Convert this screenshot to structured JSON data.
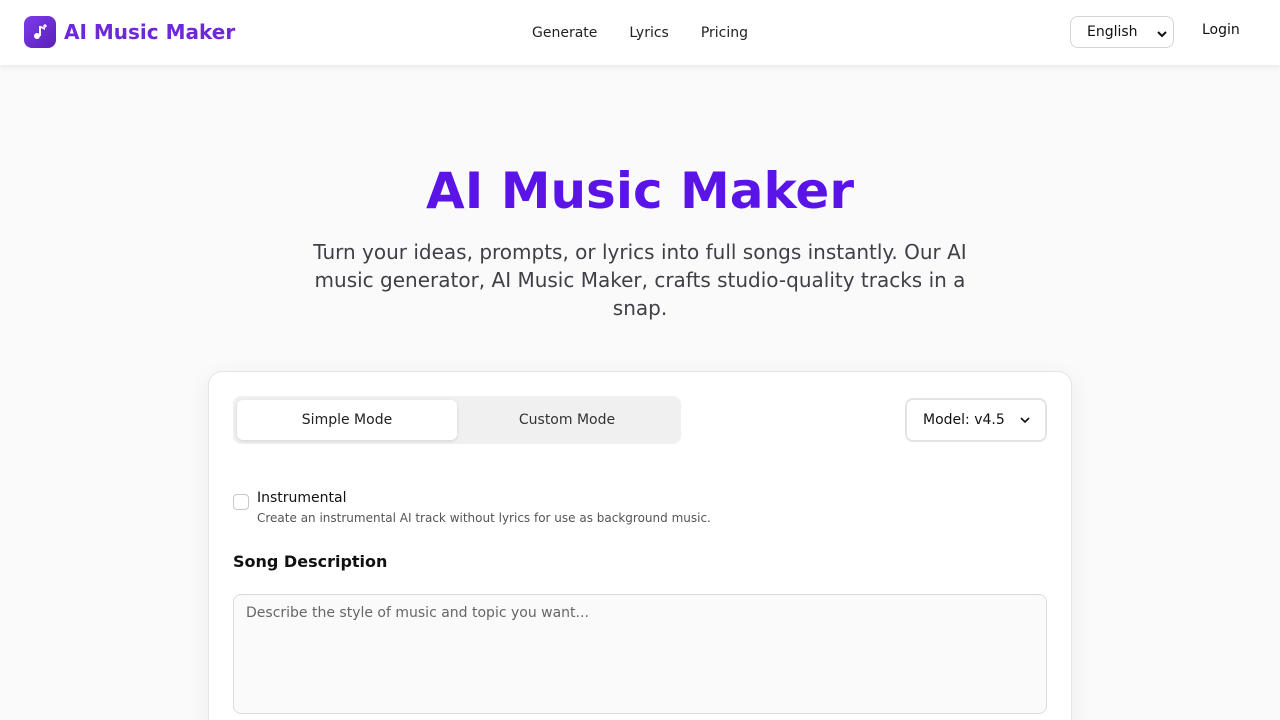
{
  "header": {
    "brand": "AI Music Maker",
    "nav": [
      "Generate",
      "Lyrics",
      "Pricing"
    ],
    "language": "English",
    "login": "Login"
  },
  "hero": {
    "title": "AI Music Maker",
    "subtitle": "Turn your ideas, prompts, or lyrics into full songs instantly. Our AI music generator, AI Music Maker, crafts studio-quality tracks in a snap."
  },
  "form": {
    "modes": [
      "Simple Mode",
      "Custom Mode"
    ],
    "active_mode": "Simple Mode",
    "model": "Model: v4.5",
    "instrumental": {
      "label": "Instrumental",
      "description": "Create an instrumental AI track without lyrics for use as background music.",
      "checked": false
    },
    "song_description": {
      "label": "Song Description",
      "placeholder": "Describe the style of music and topic you want...",
      "value": ""
    }
  },
  "colors": {
    "accent": "#5b14e8",
    "brand": "#6d28d9"
  },
  "icons": {
    "logo": "music-note-icon",
    "dropdown": "chevron-down-icon"
  }
}
